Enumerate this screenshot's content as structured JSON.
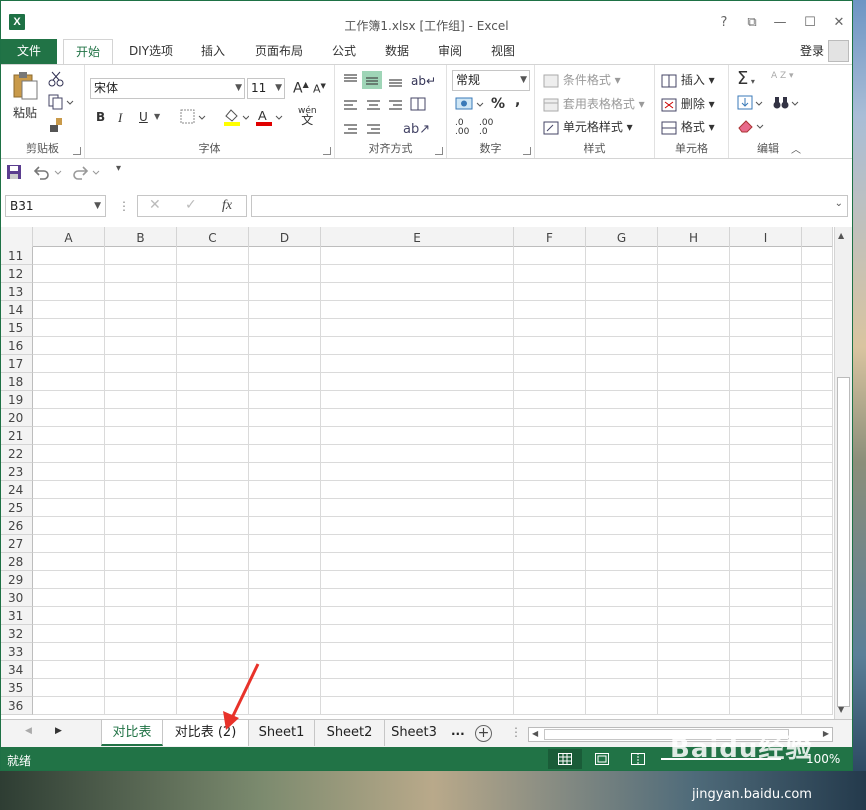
{
  "window": {
    "title": "工作簿1.xlsx  [工作组] - Excel",
    "app_icon": "X"
  },
  "titlebar_buttons": {
    "help": "?",
    "ribbon_display": "⧉",
    "minimize": "—",
    "restore": "☐",
    "close": "✕"
  },
  "tabs": [
    "文件",
    "开始",
    "DIY选项",
    "插入",
    "页面布局",
    "公式",
    "数据",
    "审阅",
    "视图"
  ],
  "login": "登录",
  "ribbon": {
    "clipboard": {
      "label": "剪贴板",
      "paste": "粘贴"
    },
    "font": {
      "label": "字体",
      "name": "宋体",
      "size": "11",
      "bold": "B",
      "italic": "I",
      "underline": "U",
      "grow": "A",
      "shrink": "A",
      "phonetic": "wén"
    },
    "alignment": {
      "label": "对齐方式"
    },
    "number": {
      "label": "数字",
      "format": "常规",
      "percent": "%",
      "comma": ",",
      "inc_decimal": ".0",
      "dec_decimal": ".00"
    },
    "styles": {
      "label": "样式",
      "conditional": "条件格式",
      "table": "套用表格格式",
      "cell": "单元格样式"
    },
    "cells": {
      "label": "单元格",
      "insert": "插入",
      "delete": "删除",
      "format": "格式"
    },
    "editing": {
      "label": "编辑",
      "sum": "Σ",
      "sort": "A Z"
    }
  },
  "formula_bar": {
    "namebox": "B31",
    "fx": "fx",
    "formula": ""
  },
  "columns": [
    "A",
    "B",
    "C",
    "D",
    "E",
    "F",
    "G",
    "H",
    "I"
  ],
  "rows": [
    "11",
    "12",
    "13",
    "14",
    "15",
    "16",
    "17",
    "18",
    "19",
    "20",
    "21",
    "22",
    "23",
    "24",
    "25",
    "26",
    "27",
    "28",
    "29",
    "30",
    "31",
    "32",
    "33",
    "34",
    "35",
    "36"
  ],
  "sheets": [
    "对比表",
    "对比表 (2)",
    "Sheet1",
    "Sheet2",
    "Sheet3"
  ],
  "sheet_more": "...",
  "status": {
    "ready": "就绪",
    "zoom": "100%"
  },
  "watermark": {
    "text": "Baidu经验",
    "url": "jingyan.baidu.com"
  },
  "colors": {
    "accent": "#217346",
    "annotation_arrow": "#e8322a"
  }
}
